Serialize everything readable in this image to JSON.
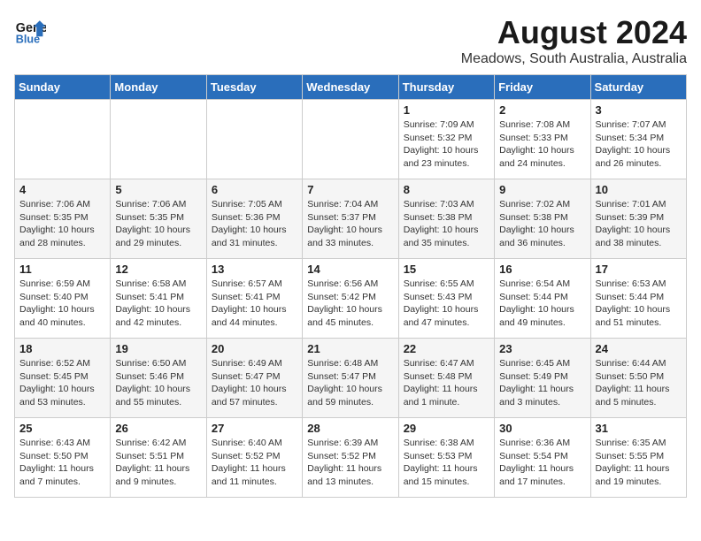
{
  "logo": {
    "line1": "General",
    "line2": "Blue"
  },
  "title": "August 2024",
  "subtitle": "Meadows, South Australia, Australia",
  "days_of_week": [
    "Sunday",
    "Monday",
    "Tuesday",
    "Wednesday",
    "Thursday",
    "Friday",
    "Saturday"
  ],
  "weeks": [
    [
      {
        "day": "",
        "info": ""
      },
      {
        "day": "",
        "info": ""
      },
      {
        "day": "",
        "info": ""
      },
      {
        "day": "",
        "info": ""
      },
      {
        "day": "1",
        "info": "Sunrise: 7:09 AM\nSunset: 5:32 PM\nDaylight: 10 hours\nand 23 minutes."
      },
      {
        "day": "2",
        "info": "Sunrise: 7:08 AM\nSunset: 5:33 PM\nDaylight: 10 hours\nand 24 minutes."
      },
      {
        "day": "3",
        "info": "Sunrise: 7:07 AM\nSunset: 5:34 PM\nDaylight: 10 hours\nand 26 minutes."
      }
    ],
    [
      {
        "day": "4",
        "info": "Sunrise: 7:06 AM\nSunset: 5:35 PM\nDaylight: 10 hours\nand 28 minutes."
      },
      {
        "day": "5",
        "info": "Sunrise: 7:06 AM\nSunset: 5:35 PM\nDaylight: 10 hours\nand 29 minutes."
      },
      {
        "day": "6",
        "info": "Sunrise: 7:05 AM\nSunset: 5:36 PM\nDaylight: 10 hours\nand 31 minutes."
      },
      {
        "day": "7",
        "info": "Sunrise: 7:04 AM\nSunset: 5:37 PM\nDaylight: 10 hours\nand 33 minutes."
      },
      {
        "day": "8",
        "info": "Sunrise: 7:03 AM\nSunset: 5:38 PM\nDaylight: 10 hours\nand 35 minutes."
      },
      {
        "day": "9",
        "info": "Sunrise: 7:02 AM\nSunset: 5:38 PM\nDaylight: 10 hours\nand 36 minutes."
      },
      {
        "day": "10",
        "info": "Sunrise: 7:01 AM\nSunset: 5:39 PM\nDaylight: 10 hours\nand 38 minutes."
      }
    ],
    [
      {
        "day": "11",
        "info": "Sunrise: 6:59 AM\nSunset: 5:40 PM\nDaylight: 10 hours\nand 40 minutes."
      },
      {
        "day": "12",
        "info": "Sunrise: 6:58 AM\nSunset: 5:41 PM\nDaylight: 10 hours\nand 42 minutes."
      },
      {
        "day": "13",
        "info": "Sunrise: 6:57 AM\nSunset: 5:41 PM\nDaylight: 10 hours\nand 44 minutes."
      },
      {
        "day": "14",
        "info": "Sunrise: 6:56 AM\nSunset: 5:42 PM\nDaylight: 10 hours\nand 45 minutes."
      },
      {
        "day": "15",
        "info": "Sunrise: 6:55 AM\nSunset: 5:43 PM\nDaylight: 10 hours\nand 47 minutes."
      },
      {
        "day": "16",
        "info": "Sunrise: 6:54 AM\nSunset: 5:44 PM\nDaylight: 10 hours\nand 49 minutes."
      },
      {
        "day": "17",
        "info": "Sunrise: 6:53 AM\nSunset: 5:44 PM\nDaylight: 10 hours\nand 51 minutes."
      }
    ],
    [
      {
        "day": "18",
        "info": "Sunrise: 6:52 AM\nSunset: 5:45 PM\nDaylight: 10 hours\nand 53 minutes."
      },
      {
        "day": "19",
        "info": "Sunrise: 6:50 AM\nSunset: 5:46 PM\nDaylight: 10 hours\nand 55 minutes."
      },
      {
        "day": "20",
        "info": "Sunrise: 6:49 AM\nSunset: 5:47 PM\nDaylight: 10 hours\nand 57 minutes."
      },
      {
        "day": "21",
        "info": "Sunrise: 6:48 AM\nSunset: 5:47 PM\nDaylight: 10 hours\nand 59 minutes."
      },
      {
        "day": "22",
        "info": "Sunrise: 6:47 AM\nSunset: 5:48 PM\nDaylight: 11 hours\nand 1 minute."
      },
      {
        "day": "23",
        "info": "Sunrise: 6:45 AM\nSunset: 5:49 PM\nDaylight: 11 hours\nand 3 minutes."
      },
      {
        "day": "24",
        "info": "Sunrise: 6:44 AM\nSunset: 5:50 PM\nDaylight: 11 hours\nand 5 minutes."
      }
    ],
    [
      {
        "day": "25",
        "info": "Sunrise: 6:43 AM\nSunset: 5:50 PM\nDaylight: 11 hours\nand 7 minutes."
      },
      {
        "day": "26",
        "info": "Sunrise: 6:42 AM\nSunset: 5:51 PM\nDaylight: 11 hours\nand 9 minutes."
      },
      {
        "day": "27",
        "info": "Sunrise: 6:40 AM\nSunset: 5:52 PM\nDaylight: 11 hours\nand 11 minutes."
      },
      {
        "day": "28",
        "info": "Sunrise: 6:39 AM\nSunset: 5:52 PM\nDaylight: 11 hours\nand 13 minutes."
      },
      {
        "day": "29",
        "info": "Sunrise: 6:38 AM\nSunset: 5:53 PM\nDaylight: 11 hours\nand 15 minutes."
      },
      {
        "day": "30",
        "info": "Sunrise: 6:36 AM\nSunset: 5:54 PM\nDaylight: 11 hours\nand 17 minutes."
      },
      {
        "day": "31",
        "info": "Sunrise: 6:35 AM\nSunset: 5:55 PM\nDaylight: 11 hours\nand 19 minutes."
      }
    ]
  ]
}
